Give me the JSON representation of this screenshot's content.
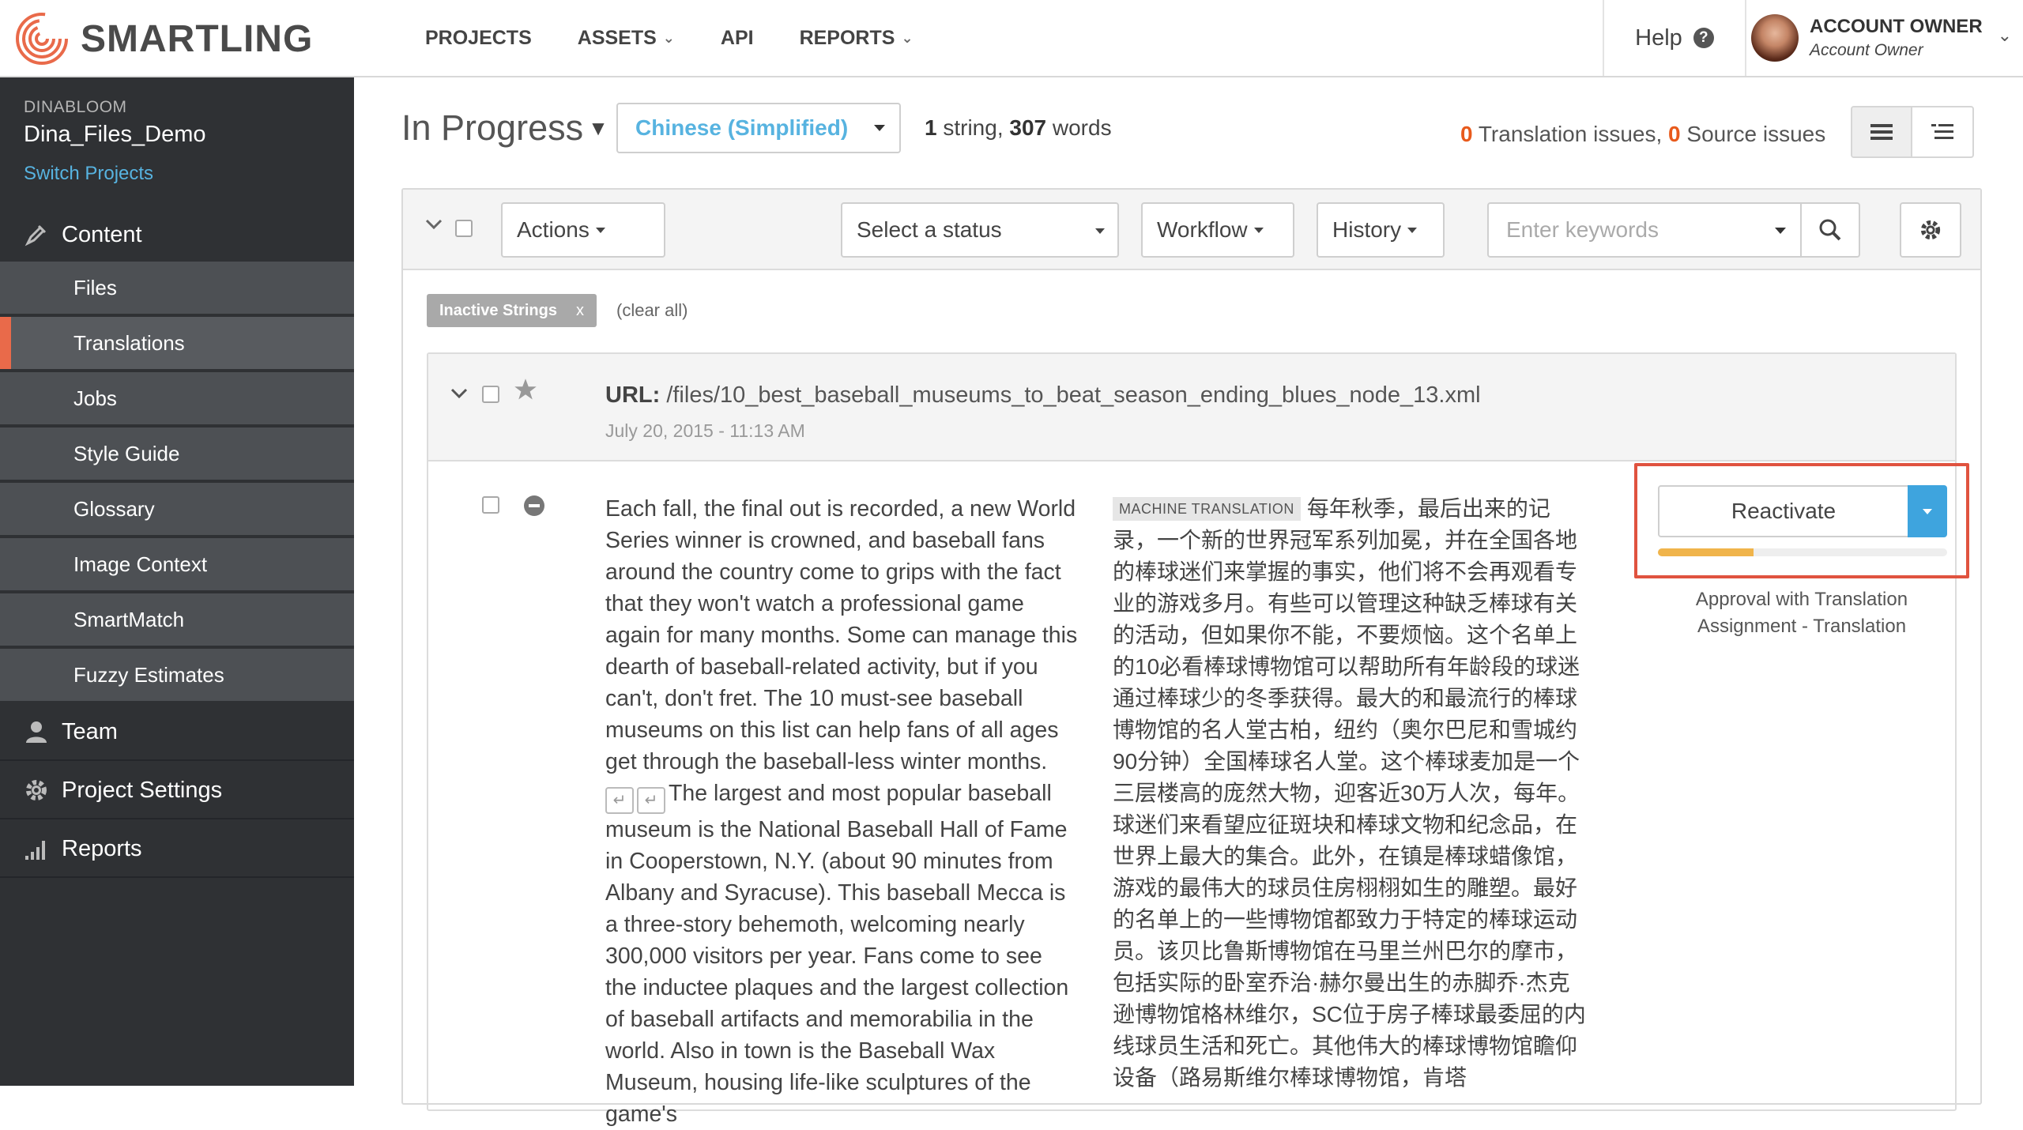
{
  "brand": {
    "name": "SMARTLING",
    "accent": "#e96a4a"
  },
  "nav": {
    "items": [
      {
        "label": "PROJECTS",
        "has_menu": false
      },
      {
        "label": "ASSETS",
        "has_menu": true
      },
      {
        "label": "API",
        "has_menu": false
      },
      {
        "label": "REPORTS",
        "has_menu": true
      }
    ],
    "help_label": "Help",
    "account": {
      "name": "ACCOUNT OWNER",
      "role": "Account Owner"
    }
  },
  "sidebar": {
    "org": "DINABLOOM",
    "project": "Dina_Files_Demo",
    "switch_label": "Switch Projects",
    "content_label": "Content",
    "content_items": [
      {
        "label": "Files",
        "active": false
      },
      {
        "label": "Translations",
        "active": true
      },
      {
        "label": "Jobs",
        "active": false
      },
      {
        "label": "Style Guide",
        "active": false
      },
      {
        "label": "Glossary",
        "active": false
      },
      {
        "label": "Image Context",
        "active": false
      },
      {
        "label": "SmartMatch",
        "active": false
      },
      {
        "label": "Fuzzy Estimates",
        "active": false
      }
    ],
    "team_label": "Team",
    "settings_label": "Project Settings",
    "reports_label": "Reports"
  },
  "header": {
    "title": "In Progress",
    "language": "Chinese (Simplified)",
    "string_count": "1",
    "string_word": " string, ",
    "word_count": "307",
    "word_word": " words",
    "translation_issues": "0",
    "translation_issues_label": " Translation issues, ",
    "source_issues": "0",
    "source_issues_label": " Source issues"
  },
  "toolbar": {
    "actions_label": "Actions",
    "status_placeholder": "Select a status",
    "workflow_label": "Workflow",
    "history_label": "History",
    "search_placeholder": "Enter keywords"
  },
  "filters": {
    "tag": "Inactive Strings",
    "tag_remove": "x",
    "clear_all": "(clear all)"
  },
  "file": {
    "url_label": "URL:",
    "url": " /files/10_best_baseball_museums_to_beat_season_ending_blues_node_13.xml",
    "date": "July 20, 2015 - 11:13 AM"
  },
  "string": {
    "source_part1": "Each fall, the final out is recorded, a new World Series winner is crowned, and baseball fans around the country come to grips with the fact that they won't watch a professional game again for many months. Some can manage this dearth of baseball-related activity, but if you can't, don't fret. The 10 must-see baseball museums on this list can help fans of all ages get through the baseball-less winter months.",
    "source_part2": "The largest and most popular baseball museum is the National Baseball Hall of Fame in Cooperstown, N.Y. (about 90 minutes from Albany and Syracuse). This baseball Mecca is a three-story behemoth, welcoming nearly 300,000 visitors per year. Fans come to see the inductee plaques and the largest collection of baseball artifacts and memorabilia in the world. Also in town is the Baseball Wax Museum, housing life-like sculptures of the game's",
    "mt_badge": "MACHINE TRANSLATION",
    "target": "每年秋季，最后出来的记录，一个新的世界冠军系列加冕，并在全国各地的棒球迷们来掌握的事实，他们将不会再观看专业的游戏多月。有些可以管理这种缺乏棒球有关的活动，但如果你不能，不要烦恼。这个名单上的10必看棒球博物馆可以帮助所有年龄段的球迷通过棒球少的冬季获得。最大的和最流行的棒球博物馆的名人堂古柏，纽约（奥尔巴尼和雪城约90分钟）全国棒球名人堂。这个棒球麦加是一个三层楼高的庞然大物，迎客近30万人次，每年。球迷们来看望应征斑块和棒球文物和纪念品，在世界上最大的集合。此外，在镇是棒球蜡像馆，游戏的最伟大的球员住房栩栩如生的雕塑。最好的名单上的一些博物馆都致力于特定的棒球运动员。该贝比鲁斯博物馆在马里兰州巴尔的摩市，包括实际的卧室乔治·赫尔曼出生的赤脚乔·杰克逊博物馆格林维尔，SC位于房子棒球最委屈的内线球员生活和死亡。其他伟大的棒球博物馆瞻仰设备（路易斯维尔棒球博物馆，肯塔",
    "action_label": "Reactivate",
    "progress": 0.33,
    "workflow_line1": "Approval with Translation",
    "workflow_line2": "Assignment - Translation"
  }
}
